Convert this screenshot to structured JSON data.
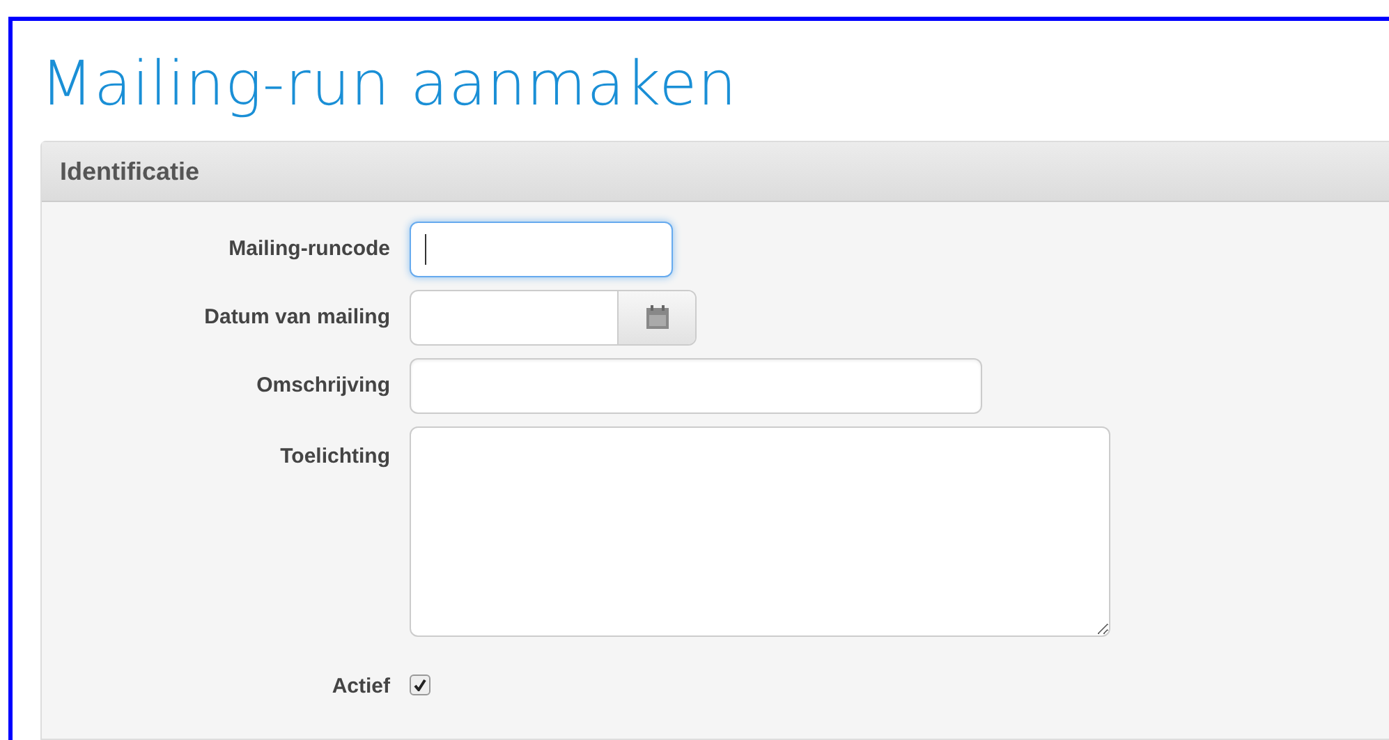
{
  "page": {
    "title": "Mailing-run aanmaken"
  },
  "panel": {
    "title": "Identificatie",
    "fields": [
      {
        "kind": "short-text",
        "label": "Mailing-runcode",
        "focused": true
      },
      {
        "kind": "date",
        "label": "Datum van mailing"
      },
      {
        "kind": "text",
        "label": "Omschrijving",
        "focused": false
      },
      {
        "kind": "textarea",
        "label": "Toelichting"
      },
      {
        "kind": "checkbox",
        "label": "Actief",
        "checked": true
      }
    ]
  }
}
